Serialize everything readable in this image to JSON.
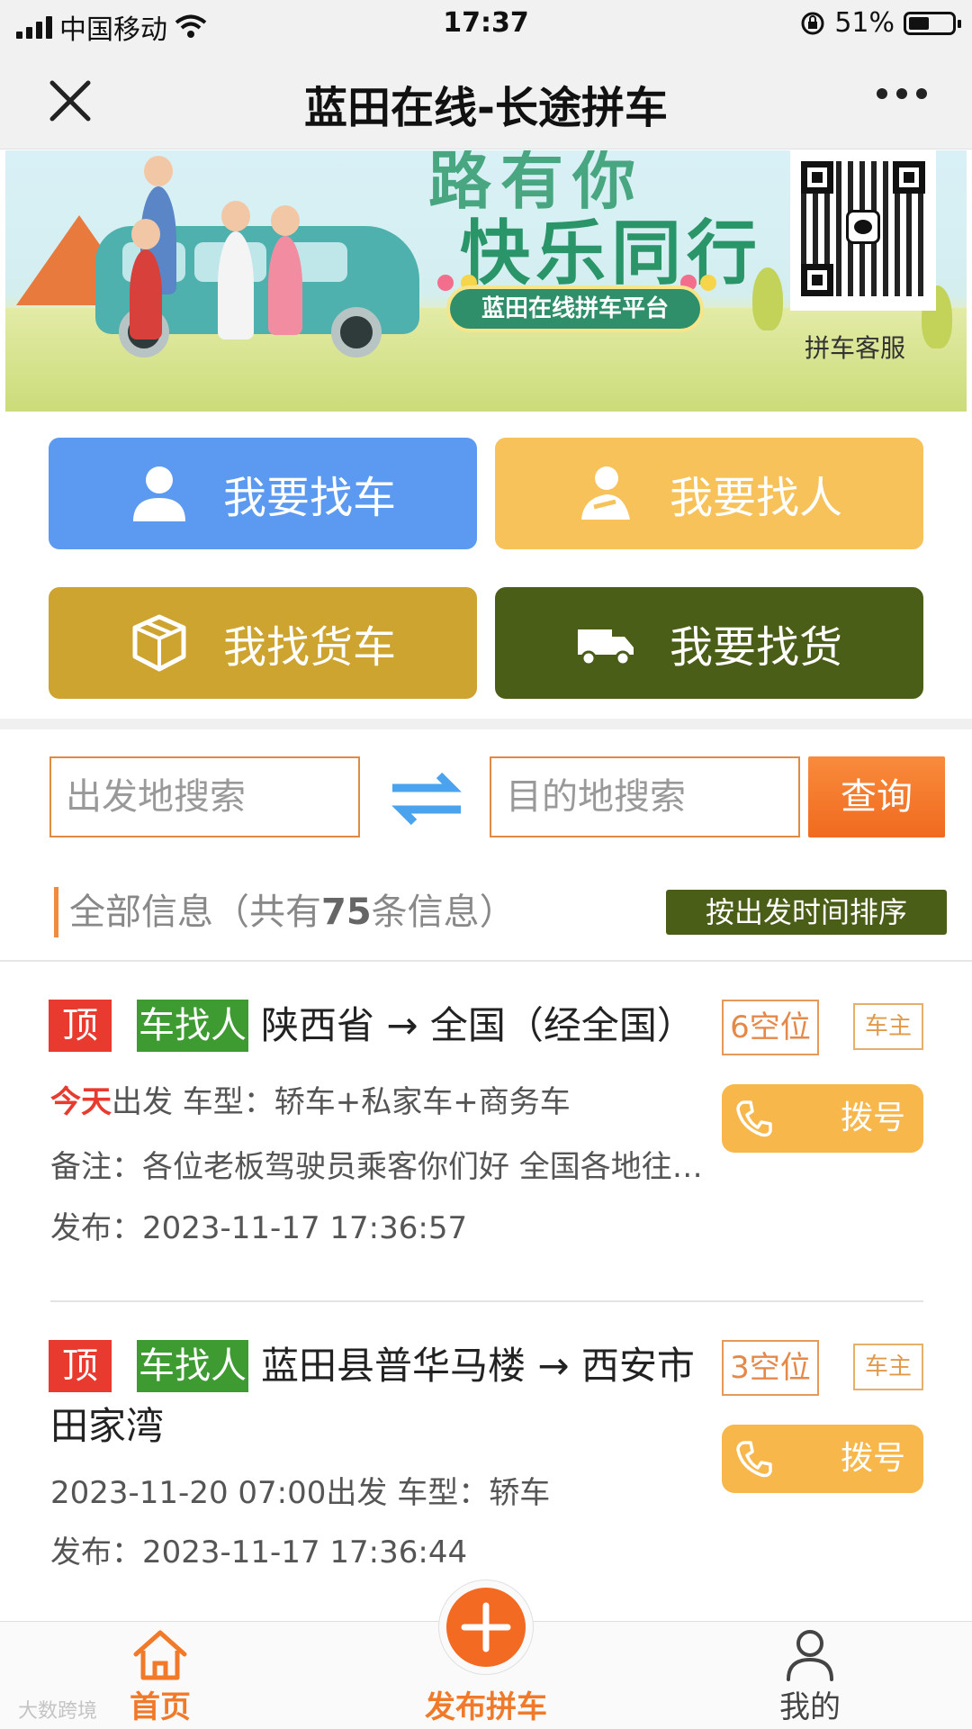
{
  "status_bar": {
    "carrier": "中国移动",
    "time": "17:37",
    "battery": "51%"
  },
  "nav": {
    "title": "蓝田在线-长途拼车"
  },
  "banner": {
    "slogan_partial": "路有你",
    "slogan": "快乐同行",
    "platform": "蓝田在线拼车平台",
    "qr_label": "拼车客服"
  },
  "actions": {
    "find_car": "我要找车",
    "find_person": "我要找人",
    "find_truck": "我找货车",
    "find_goods": "我要找货"
  },
  "search": {
    "from_placeholder": "出发地搜索",
    "to_placeholder": "目的地搜索",
    "query_label": "查询"
  },
  "list_header": {
    "prefix": "全部信息（共有",
    "count": "75",
    "suffix": "条信息）",
    "sort_label": "按出发时间排序"
  },
  "items": [
    {
      "top_tag": "顶",
      "type_tag": "车找人",
      "route": "陕西省 → 全国（经全国）",
      "seats": "6空位",
      "owner": "车主",
      "dial": "拨号",
      "depart_highlight": "今天",
      "depart_rest": "出发 车型：轿车+私家车+商务车",
      "remark": "备注：各位老板驾驶员乘客你们好 全国各地往…",
      "published": "发布：2023-11-17 17:36:57"
    },
    {
      "top_tag": "顶",
      "type_tag": "车找人",
      "route_line1": "蓝田县普华马楼 → 西安市",
      "route_line2": "田家湾",
      "seats": "3空位",
      "owner": "车主",
      "dial": "拨号",
      "depart": "2023-11-20 07:00出发 车型：轿车",
      "published": "发布：2023-11-17 17:36:44"
    }
  ],
  "tabbar": {
    "home": "首页",
    "publish": "发布拼车",
    "me": "我的"
  },
  "watermark": "大数跨境",
  "colors": {
    "accent": "#f07a2a",
    "blue_button": "#5b9af0",
    "yellow_button": "#f7c259",
    "gold_button": "#cda42f",
    "olive_button": "#4b5e17",
    "top_tag": "#e83a2e",
    "type_tag": "#3d9b31"
  }
}
